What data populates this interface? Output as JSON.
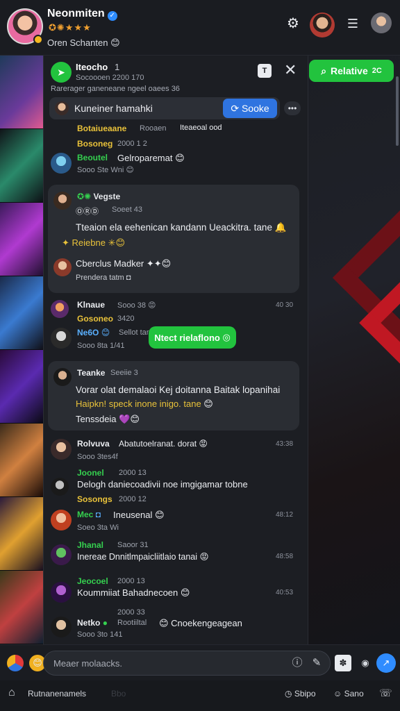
{
  "header": {
    "name": "Neonmiten",
    "badges": "✪✺★★★",
    "status": "Oren Schanten",
    "status_emoji": "😊",
    "settings_icon": "gear-icon",
    "menu_icon": "menu-icon"
  },
  "panel": {
    "title": "Iteocho",
    "title_count": "1",
    "subtitle": "Socoooen  2200 170",
    "subtitle2": "Rarerager ganeneane ngeel oaees 36",
    "search_placeholder": "Kuneiner hamahki",
    "search_button": "Sooke",
    "relative_button": "Relative",
    "relative_count": "2C"
  },
  "messages": [
    {
      "name": "Botaiueaane",
      "meta": "Rooaen",
      "text": "Iteaeoal ood",
      "time": ""
    },
    {
      "name": "Bosoneg",
      "meta": "2000 1 2",
      "time": ""
    },
    {
      "name": "Beoutel",
      "meta": "Gelroparemat",
      "sub": "Sooo Ste Wni"
    },
    {
      "bubble": true,
      "name": "Vegste",
      "meta": "Soeet 43",
      "tag": "ⓄⓇⒹ",
      "text": "Tteaion ela eehenican kandann Ueackitra. tane",
      "link": "Reiebne",
      "name2": "Cberclus Madker",
      "sub2": "Prendera  tatm"
    },
    {
      "name": "Klnaue",
      "meta": "Sooo 38",
      "time": "40 30",
      "name2": "Gosoneo",
      "meta2": "3420"
    },
    {
      "name": "Ne6O",
      "meta": "Sellot tar",
      "sub": "Sooo 8ta 1/41",
      "pill": "Ntect rielaflono"
    },
    {
      "bubble": true,
      "name": "Teanke",
      "meta": "Seeiie 3",
      "text": "Vorar olat demalaoi Kej doitanna Baitak lopanihai",
      "text2": "Haipkn! speck inone inigo. tane",
      "text3": "Tenssdeia"
    },
    {
      "name": "Rolvuva",
      "meta": "Abatutoelranat. dorat",
      "sub": "Sooo 3tes4f",
      "time": "43:38"
    },
    {
      "name": "Joonel",
      "meta": "2000 13",
      "text": "Delogh daniecoadivii noe imgigamar tobne",
      "sub": "Sosongs",
      "meta2": "2000 12"
    },
    {
      "name": "Mec",
      "meta": "Ineusenal",
      "sub": "Soeo 3ta Wi",
      "time": "48:12"
    },
    {
      "name": "Jhanal",
      "meta": "Saoor 31",
      "text": "Inereae Dnnitlmpaicliitlaio tanai",
      "time": "48:58"
    },
    {
      "name": "Jeocoel",
      "meta": "2000 13",
      "text": "Koummiiat Bahadnecoen",
      "time": "40:53"
    },
    {
      "name": "Netko",
      "meta": "Rootiiltal",
      "text": "Cnoekengeagean",
      "meta2": "2000 33",
      "sub": "Sooo 3to 141"
    }
  ],
  "composer": {
    "placeholder": "Meaer molaacks."
  },
  "bottom_nav": {
    "home_label": "Rutnanenamels",
    "item2": "Bbo",
    "item3": "Sbipo",
    "item4": "Sano"
  },
  "colors": {
    "accent_green": "#22c33e",
    "accent_blue": "#2f74e0",
    "background": "#15171b",
    "panel": "#1c1e23"
  }
}
